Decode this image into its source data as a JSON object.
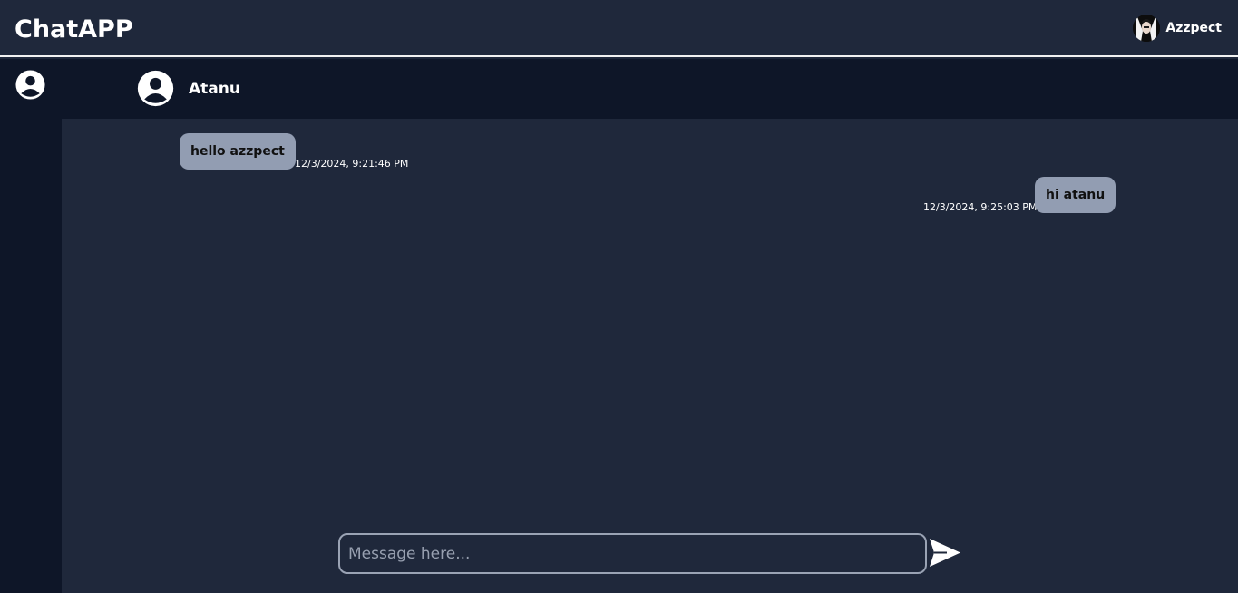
{
  "app": {
    "title": "ChatAPP"
  },
  "current_user": {
    "name": "Azzpect",
    "avatar_icon": "user-photo-avatar"
  },
  "chat": {
    "contact_name": "Atanu",
    "messages": [
      {
        "text": "hello azzpect",
        "timestamp": "12/3/2024, 9:21:46 PM",
        "direction": "incoming"
      },
      {
        "text": "hi atanu",
        "timestamp": "12/3/2024, 9:25:03 PM",
        "direction": "outgoing"
      }
    ]
  },
  "composer": {
    "placeholder": "Message here...",
    "value": "",
    "send_icon": "send-icon"
  },
  "colors": {
    "background": "#1f283b",
    "panel": "#0e1628",
    "bubble": "#929db2",
    "text": "#ffffff"
  }
}
